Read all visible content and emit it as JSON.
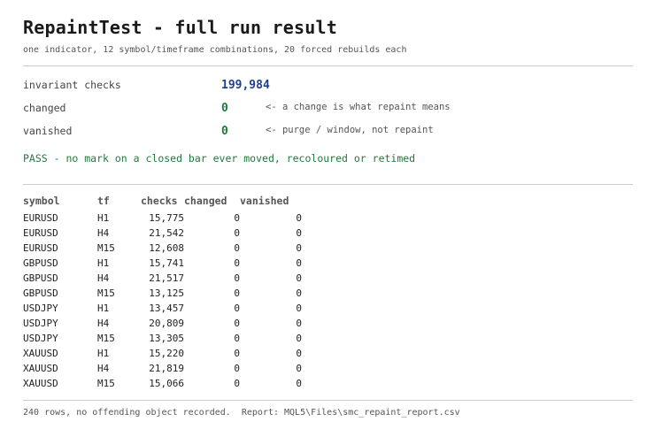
{
  "header": {
    "title": "RepaintTest - full run result",
    "subtitle": "one indicator, 12 symbol/timeframe combinations, 20 forced rebuilds each"
  },
  "stats": [
    {
      "label": "invariant checks",
      "value": "199,984",
      "note": "",
      "color": "#1f3f8f"
    },
    {
      "label": "changed",
      "value": "0",
      "note": "<- a change is what repaint means",
      "color": "#1f7a3d"
    },
    {
      "label": "vanished",
      "value": "0",
      "note": "<- purge / window, not repaint",
      "color": "#1f7a3d"
    }
  ],
  "verdict": "PASS - no mark on a closed bar ever moved, recoloured or retimed",
  "table": {
    "headers": [
      "symbol",
      "tf",
      "checks",
      "changed",
      "vanished"
    ],
    "rows": [
      [
        "EURUSD",
        "H1",
        "15,775",
        "0",
        "0"
      ],
      [
        "EURUSD",
        "H4",
        "21,542",
        "0",
        "0"
      ],
      [
        "EURUSD",
        "M15",
        "12,608",
        "0",
        "0"
      ],
      [
        "GBPUSD",
        "H1",
        "15,741",
        "0",
        "0"
      ],
      [
        "GBPUSD",
        "H4",
        "21,517",
        "0",
        "0"
      ],
      [
        "GBPUSD",
        "M15",
        "13,125",
        "0",
        "0"
      ],
      [
        "USDJPY",
        "H1",
        "13,457",
        "0",
        "0"
      ],
      [
        "USDJPY",
        "H4",
        "20,809",
        "0",
        "0"
      ],
      [
        "USDJPY",
        "M15",
        "13,305",
        "0",
        "0"
      ],
      [
        "XAUUSD",
        "H1",
        "15,220",
        "0",
        "0"
      ],
      [
        "XAUUSD",
        "H4",
        "21,819",
        "0",
        "0"
      ],
      [
        "XAUUSD",
        "M15",
        "15,066",
        "0",
        "0"
      ]
    ]
  },
  "footer": "240 rows, no offending object recorded.  Report: MQL5\\Files\\smc_repaint_report.csv"
}
